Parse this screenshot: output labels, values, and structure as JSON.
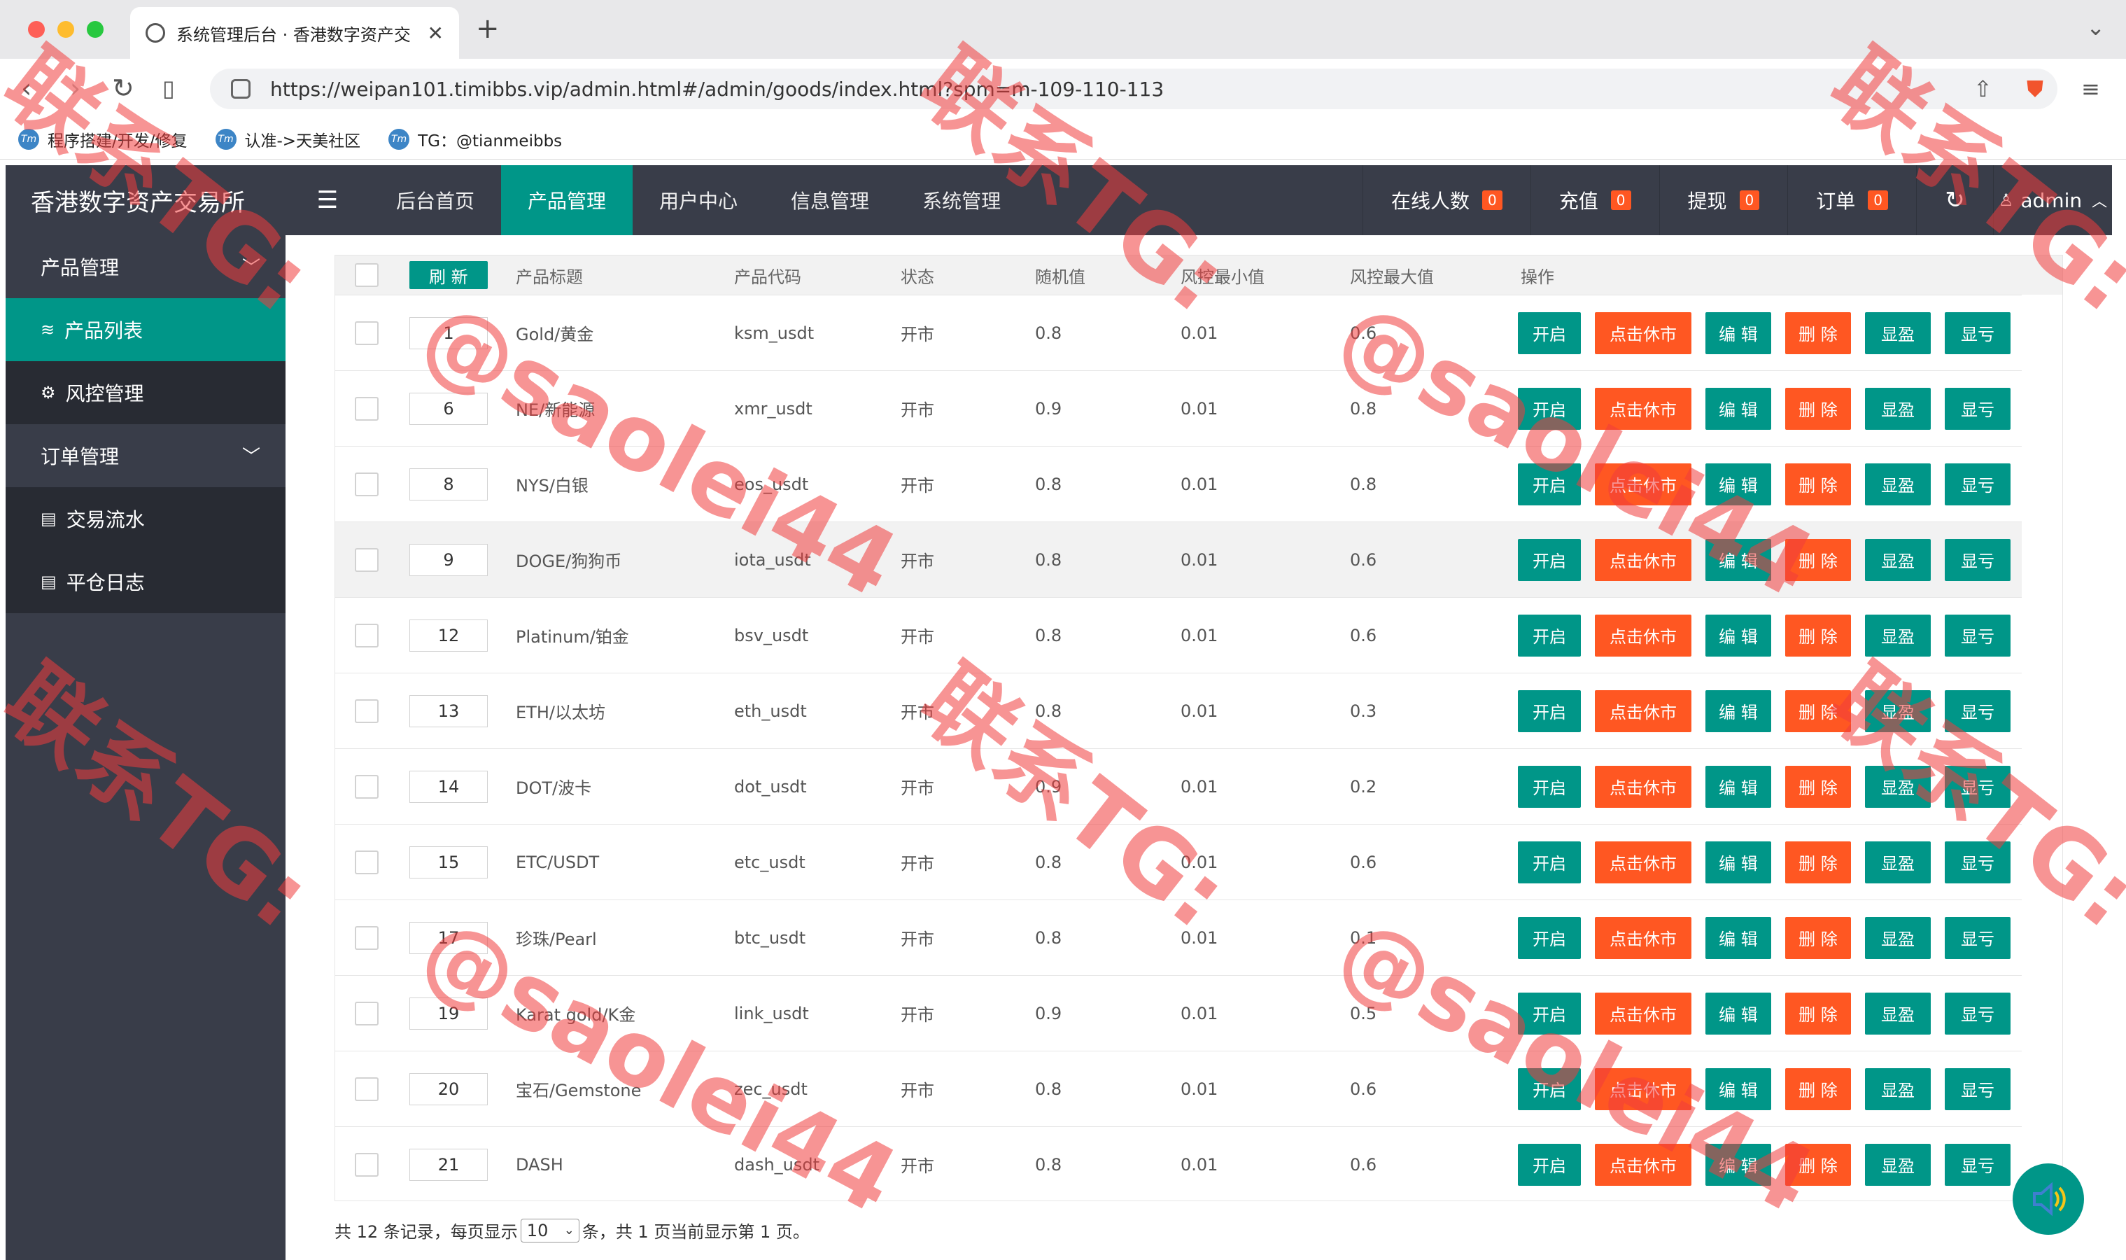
{
  "browser": {
    "tab_title": "系统管理后台 · 香港数字资产交",
    "url": "https://weipan101.timibbs.vip/admin.html#/admin/goods/index.html?spm=m-109-110-113",
    "bookmarks": [
      "程序搭建/开发/修复",
      "认准->天美社区",
      "TG：@tianmeibbs"
    ]
  },
  "app": {
    "brand": "香港数字资产交易所",
    "nav": [
      "后台首页",
      "产品管理",
      "用户中心",
      "信息管理",
      "系统管理"
    ],
    "active_nav": "产品管理",
    "stats": [
      {
        "label": "在线人数",
        "count": "0"
      },
      {
        "label": "充值",
        "count": "0"
      },
      {
        "label": "提现",
        "count": "0"
      },
      {
        "label": "订单",
        "count": "0"
      }
    ],
    "user": "admin"
  },
  "sidebar": {
    "group1": "产品管理",
    "item_product_list": "产品列表",
    "item_risk": "风控管理",
    "group2": "订单管理",
    "item_flow": "交易流水",
    "item_log": "平仓日志"
  },
  "table": {
    "refresh_label": "刷 新",
    "headers": {
      "title": "产品标题",
      "code": "产品代码",
      "status": "状态",
      "random": "随机值",
      "risk_min": "风控最小值",
      "risk_max": "风控最大值",
      "ops": "操作"
    },
    "buttons": {
      "open": "开启",
      "close": "点击休市",
      "edit": "编 辑",
      "delete": "删 除",
      "show_win": "显盈",
      "show_loss": "显亏"
    },
    "rows": [
      {
        "order": "1",
        "title": "Gold/黄金",
        "code": "ksm_usdt",
        "status": "开市",
        "random": "0.8",
        "min": "0.01",
        "max": "0.6"
      },
      {
        "order": "6",
        "title": "NE/新能源",
        "code": "xmr_usdt",
        "status": "开市",
        "random": "0.9",
        "min": "0.01",
        "max": "0.8"
      },
      {
        "order": "8",
        "title": "NYS/白银",
        "code": "eos_usdt",
        "status": "开市",
        "random": "0.8",
        "min": "0.01",
        "max": "0.8"
      },
      {
        "order": "9",
        "title": "DOGE/狗狗币",
        "code": "iota_usdt",
        "status": "开市",
        "random": "0.8",
        "min": "0.01",
        "max": "0.6"
      },
      {
        "order": "12",
        "title": "Platinum/铂金",
        "code": "bsv_usdt",
        "status": "开市",
        "random": "0.8",
        "min": "0.01",
        "max": "0.6"
      },
      {
        "order": "13",
        "title": "ETH/以太坊",
        "code": "eth_usdt",
        "status": "开市",
        "random": "0.8",
        "min": "0.01",
        "max": "0.3"
      },
      {
        "order": "14",
        "title": "DOT/波卡",
        "code": "dot_usdt",
        "status": "开市",
        "random": "0.9",
        "min": "0.01",
        "max": "0.2"
      },
      {
        "order": "15",
        "title": "ETC/USDT",
        "code": "etc_usdt",
        "status": "开市",
        "random": "0.8",
        "min": "0.01",
        "max": "0.6"
      },
      {
        "order": "17",
        "title": "珍珠/Pearl",
        "code": "btc_usdt",
        "status": "开市",
        "random": "0.8",
        "min": "0.01",
        "max": "0.1"
      },
      {
        "order": "19",
        "title": "Karat gold/K金",
        "code": "link_usdt",
        "status": "开市",
        "random": "0.9",
        "min": "0.01",
        "max": "0.5"
      },
      {
        "order": "20",
        "title": "宝石/Gemstone",
        "code": "zec_usdt",
        "status": "开市",
        "random": "0.8",
        "min": "0.01",
        "max": "0.6"
      },
      {
        "order": "21",
        "title": "DASH",
        "code": "dash_usdt",
        "status": "开市",
        "random": "0.8",
        "min": "0.01",
        "max": "0.6"
      }
    ]
  },
  "pager": {
    "prefix": "共 12 条记录，每页显示",
    "page_size": "10",
    "suffix": "条，共 1 页当前显示第 1 页。"
  },
  "watermark": {
    "line1": "联系TG:",
    "line2": "@saolei44"
  },
  "colors": {
    "accent": "#009688",
    "danger": "#ff5722",
    "nav_bg": "#393d49"
  }
}
